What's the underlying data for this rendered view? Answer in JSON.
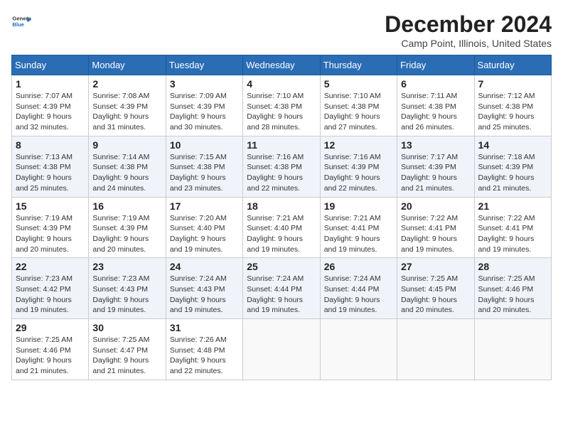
{
  "logo": {
    "general": "General",
    "blue": "Blue"
  },
  "title": "December 2024",
  "location": "Camp Point, Illinois, United States",
  "days_of_week": [
    "Sunday",
    "Monday",
    "Tuesday",
    "Wednesday",
    "Thursday",
    "Friday",
    "Saturday"
  ],
  "weeks": [
    [
      {
        "num": "1",
        "sunrise": "7:07 AM",
        "sunset": "4:39 PM",
        "daylight": "9 hours and 32 minutes."
      },
      {
        "num": "2",
        "sunrise": "7:08 AM",
        "sunset": "4:39 PM",
        "daylight": "9 hours and 31 minutes."
      },
      {
        "num": "3",
        "sunrise": "7:09 AM",
        "sunset": "4:39 PM",
        "daylight": "9 hours and 30 minutes."
      },
      {
        "num": "4",
        "sunrise": "7:10 AM",
        "sunset": "4:38 PM",
        "daylight": "9 hours and 28 minutes."
      },
      {
        "num": "5",
        "sunrise": "7:10 AM",
        "sunset": "4:38 PM",
        "daylight": "9 hours and 27 minutes."
      },
      {
        "num": "6",
        "sunrise": "7:11 AM",
        "sunset": "4:38 PM",
        "daylight": "9 hours and 26 minutes."
      },
      {
        "num": "7",
        "sunrise": "7:12 AM",
        "sunset": "4:38 PM",
        "daylight": "9 hours and 25 minutes."
      }
    ],
    [
      {
        "num": "8",
        "sunrise": "7:13 AM",
        "sunset": "4:38 PM",
        "daylight": "9 hours and 25 minutes."
      },
      {
        "num": "9",
        "sunrise": "7:14 AM",
        "sunset": "4:38 PM",
        "daylight": "9 hours and 24 minutes."
      },
      {
        "num": "10",
        "sunrise": "7:15 AM",
        "sunset": "4:38 PM",
        "daylight": "9 hours and 23 minutes."
      },
      {
        "num": "11",
        "sunrise": "7:16 AM",
        "sunset": "4:38 PM",
        "daylight": "9 hours and 22 minutes."
      },
      {
        "num": "12",
        "sunrise": "7:16 AM",
        "sunset": "4:39 PM",
        "daylight": "9 hours and 22 minutes."
      },
      {
        "num": "13",
        "sunrise": "7:17 AM",
        "sunset": "4:39 PM",
        "daylight": "9 hours and 21 minutes."
      },
      {
        "num": "14",
        "sunrise": "7:18 AM",
        "sunset": "4:39 PM",
        "daylight": "9 hours and 21 minutes."
      }
    ],
    [
      {
        "num": "15",
        "sunrise": "7:19 AM",
        "sunset": "4:39 PM",
        "daylight": "9 hours and 20 minutes."
      },
      {
        "num": "16",
        "sunrise": "7:19 AM",
        "sunset": "4:39 PM",
        "daylight": "9 hours and 20 minutes."
      },
      {
        "num": "17",
        "sunrise": "7:20 AM",
        "sunset": "4:40 PM",
        "daylight": "9 hours and 19 minutes."
      },
      {
        "num": "18",
        "sunrise": "7:21 AM",
        "sunset": "4:40 PM",
        "daylight": "9 hours and 19 minutes."
      },
      {
        "num": "19",
        "sunrise": "7:21 AM",
        "sunset": "4:41 PM",
        "daylight": "9 hours and 19 minutes."
      },
      {
        "num": "20",
        "sunrise": "7:22 AM",
        "sunset": "4:41 PM",
        "daylight": "9 hours and 19 minutes."
      },
      {
        "num": "21",
        "sunrise": "7:22 AM",
        "sunset": "4:41 PM",
        "daylight": "9 hours and 19 minutes."
      }
    ],
    [
      {
        "num": "22",
        "sunrise": "7:23 AM",
        "sunset": "4:42 PM",
        "daylight": "9 hours and 19 minutes."
      },
      {
        "num": "23",
        "sunrise": "7:23 AM",
        "sunset": "4:43 PM",
        "daylight": "9 hours and 19 minutes."
      },
      {
        "num": "24",
        "sunrise": "7:24 AM",
        "sunset": "4:43 PM",
        "daylight": "9 hours and 19 minutes."
      },
      {
        "num": "25",
        "sunrise": "7:24 AM",
        "sunset": "4:44 PM",
        "daylight": "9 hours and 19 minutes."
      },
      {
        "num": "26",
        "sunrise": "7:24 AM",
        "sunset": "4:44 PM",
        "daylight": "9 hours and 19 minutes."
      },
      {
        "num": "27",
        "sunrise": "7:25 AM",
        "sunset": "4:45 PM",
        "daylight": "9 hours and 20 minutes."
      },
      {
        "num": "28",
        "sunrise": "7:25 AM",
        "sunset": "4:46 PM",
        "daylight": "9 hours and 20 minutes."
      }
    ],
    [
      {
        "num": "29",
        "sunrise": "7:25 AM",
        "sunset": "4:46 PM",
        "daylight": "9 hours and 21 minutes."
      },
      {
        "num": "30",
        "sunrise": "7:25 AM",
        "sunset": "4:47 PM",
        "daylight": "9 hours and 21 minutes."
      },
      {
        "num": "31",
        "sunrise": "7:26 AM",
        "sunset": "4:48 PM",
        "daylight": "9 hours and 22 minutes."
      },
      null,
      null,
      null,
      null
    ]
  ],
  "labels": {
    "sunrise": "Sunrise:",
    "sunset": "Sunset:",
    "daylight": "Daylight:"
  }
}
